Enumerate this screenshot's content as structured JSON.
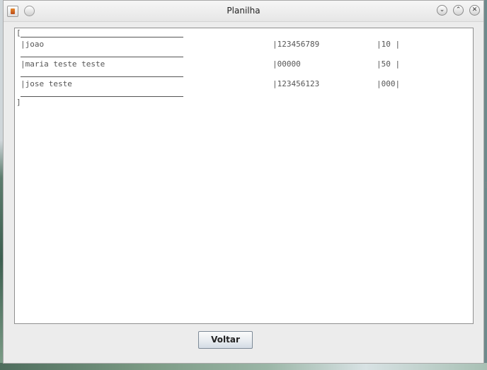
{
  "window": {
    "title": "Planilha",
    "controls": [
      "minimize",
      "maximize",
      "close"
    ]
  },
  "textarea": {
    "open_bracket": "[",
    "close_bracket": "]",
    "rows": [
      {
        "name": "|joao",
        "phone": "|123456789",
        "value": "|10 |"
      },
      {
        "name": "|maria teste teste",
        "phone": "|00000",
        "value": "|50 |"
      },
      {
        "name": "|jose teste",
        "phone": "|123456123",
        "value": "|000|"
      }
    ]
  },
  "buttons": {
    "voltar_label": "Voltar"
  },
  "icons": {
    "app_icon": "java-icon",
    "menu": "window-menu-icon",
    "minimize": "chevron-down-icon",
    "maximize": "chevron-up-icon",
    "close": "close-icon"
  }
}
